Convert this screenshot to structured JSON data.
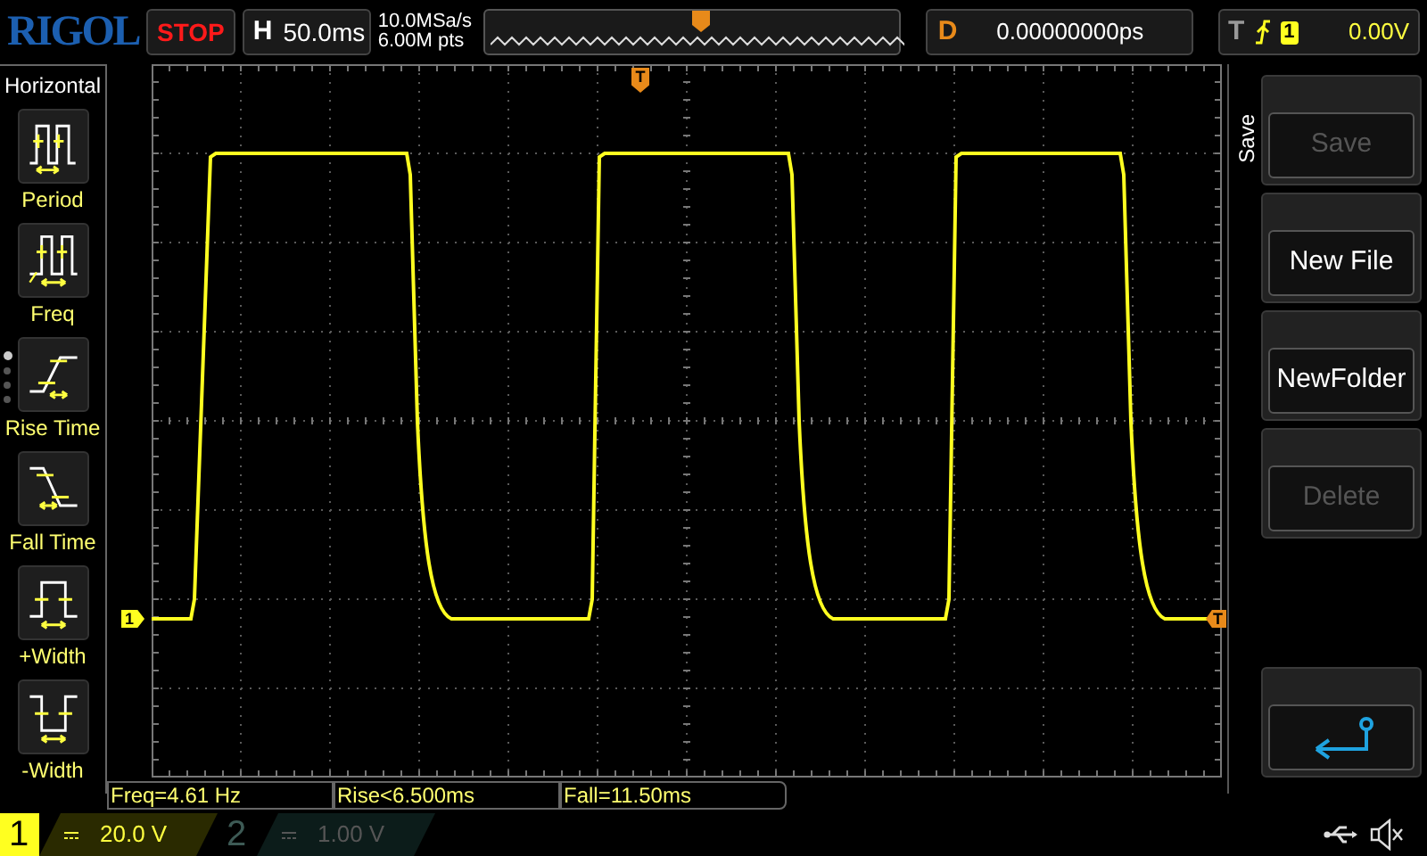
{
  "logo": "RIGOL",
  "run_status": "STOP",
  "horizontal": {
    "label": "H",
    "value": "50.0ms"
  },
  "acquisition": {
    "sample_rate": "10.0MSa/s",
    "memory_depth": "6.00M pts"
  },
  "delay": {
    "label": "D",
    "value": "0.00000000ps"
  },
  "trigger": {
    "label": "T",
    "source": "1",
    "level": "0.00V"
  },
  "left_menu": {
    "title": "Horizontal",
    "pages": [
      {
        "selected": true
      },
      {
        "selected": false
      },
      {
        "selected": false
      },
      {
        "selected": false
      }
    ],
    "items": [
      {
        "kind": "period",
        "label": "Period"
      },
      {
        "kind": "freq",
        "label": "Freq"
      },
      {
        "kind": "rise",
        "label": "Rise Time"
      },
      {
        "kind": "fall",
        "label": "Fall Time"
      },
      {
        "kind": "pwidth",
        "label": "+Width"
      },
      {
        "kind": "nwidth",
        "label": "-Width"
      }
    ]
  },
  "markers": {
    "channel": "1",
    "trigger_position": "T",
    "trigger_level": "T"
  },
  "measurements": [
    "Freq=4.61 Hz",
    "Rise<6.500ms",
    "Fall=11.50ms"
  ],
  "right_menu": {
    "title": "Save",
    "buttons": [
      {
        "kind": "text",
        "label": "Save",
        "disabled": true
      },
      {
        "kind": "text",
        "label": "New File",
        "disabled": false
      },
      {
        "kind": "text",
        "label": "NewFolder",
        "disabled": false
      },
      {
        "kind": "text",
        "label": "Delete",
        "disabled": true
      },
      {
        "kind": "gap"
      },
      {
        "kind": "back",
        "disabled": false
      }
    ]
  },
  "channels": [
    {
      "number": "1",
      "scale": "20.0 V",
      "enabled": true
    },
    {
      "number": "2",
      "scale": "1.00 V",
      "enabled": false
    }
  ]
}
